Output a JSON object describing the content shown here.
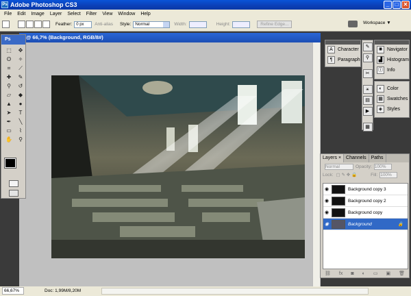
{
  "app": {
    "title": "Adobe Photoshop CS3",
    "logo": "Ps"
  },
  "window_buttons": {
    "minimize": "_",
    "maximize": "□",
    "close": "✕"
  },
  "menu": [
    "File",
    "Edit",
    "Image",
    "Layer",
    "Select",
    "Filter",
    "View",
    "Window",
    "Help"
  ],
  "options": {
    "feather_label": "Feather:",
    "feather_value": "0 px",
    "antialias_label": "Anti-alias",
    "style_label": "Style:",
    "style_value": "Normal",
    "width_label": "Width:",
    "height_label": "Height:",
    "refine_label": "Refine Edge...",
    "workspace_label": "Workspace ▼"
  },
  "document": {
    "title": "@ 66,7% (Background, RGB/8#)"
  },
  "toolbox": {
    "head": "Ps"
  },
  "panels": {
    "character": "Character",
    "paragraph": "Paragraph",
    "navigator": "Navigator",
    "histogram": "Histogram",
    "info": "Info",
    "color": "Color",
    "swatches": "Swatches",
    "styles": "Styles"
  },
  "layers_panel": {
    "tabs": [
      "Layers ×",
      "Channels",
      "Paths"
    ],
    "blend": "Normal",
    "opacity_label": "Opacity:",
    "opacity_value": "100%",
    "lock_label": "Lock:",
    "fill_label": "Fill:",
    "fill_value": "100%",
    "layers": [
      {
        "name": "Background copy 3",
        "selected": false
      },
      {
        "name": "Background copy 2",
        "selected": false
      },
      {
        "name": "Background copy",
        "selected": false
      },
      {
        "name": "Background",
        "selected": true
      }
    ]
  },
  "status": {
    "zoom": "66,67%",
    "doc": "Doc: 1,99M/8,20M"
  }
}
